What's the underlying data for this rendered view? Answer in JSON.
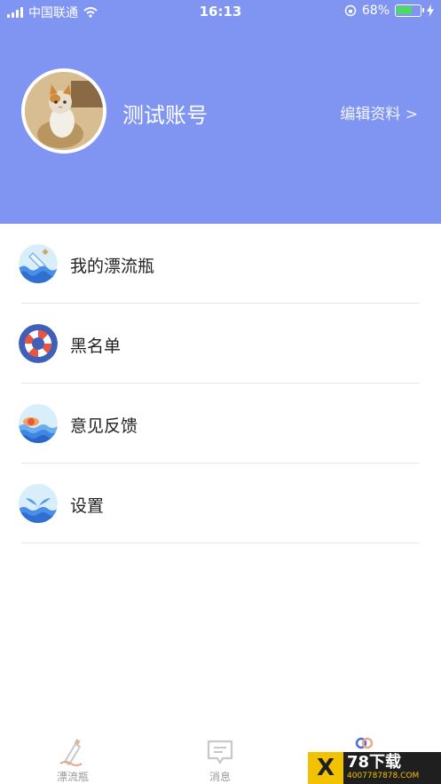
{
  "status_bar": {
    "carrier": "中国联通",
    "time": "16:13",
    "battery_percent": "68%",
    "battery_level": 0.68
  },
  "profile": {
    "name": "测试账号",
    "edit_label": "编辑资料 >"
  },
  "menu": {
    "items": [
      {
        "label": "我的漂流瓶",
        "icon": "bottle-wave-icon"
      },
      {
        "label": "黑名单",
        "icon": "lifebuoy-icon"
      },
      {
        "label": "意见反馈",
        "icon": "sunset-sea-icon"
      },
      {
        "label": "设置",
        "icon": "whale-tail-icon"
      }
    ]
  },
  "tabbar": {
    "tabs": [
      {
        "label": "漂流瓶",
        "icon": "bottle-icon"
      },
      {
        "label": "消息",
        "icon": "message-icon"
      },
      {
        "label": "",
        "icon": "profile-icon"
      }
    ]
  },
  "watermark": {
    "brand": "78下载",
    "url": "4007787878.COM"
  },
  "colors": {
    "header_bg": "#8095f2",
    "accent_blue": "#4a8ee8"
  }
}
